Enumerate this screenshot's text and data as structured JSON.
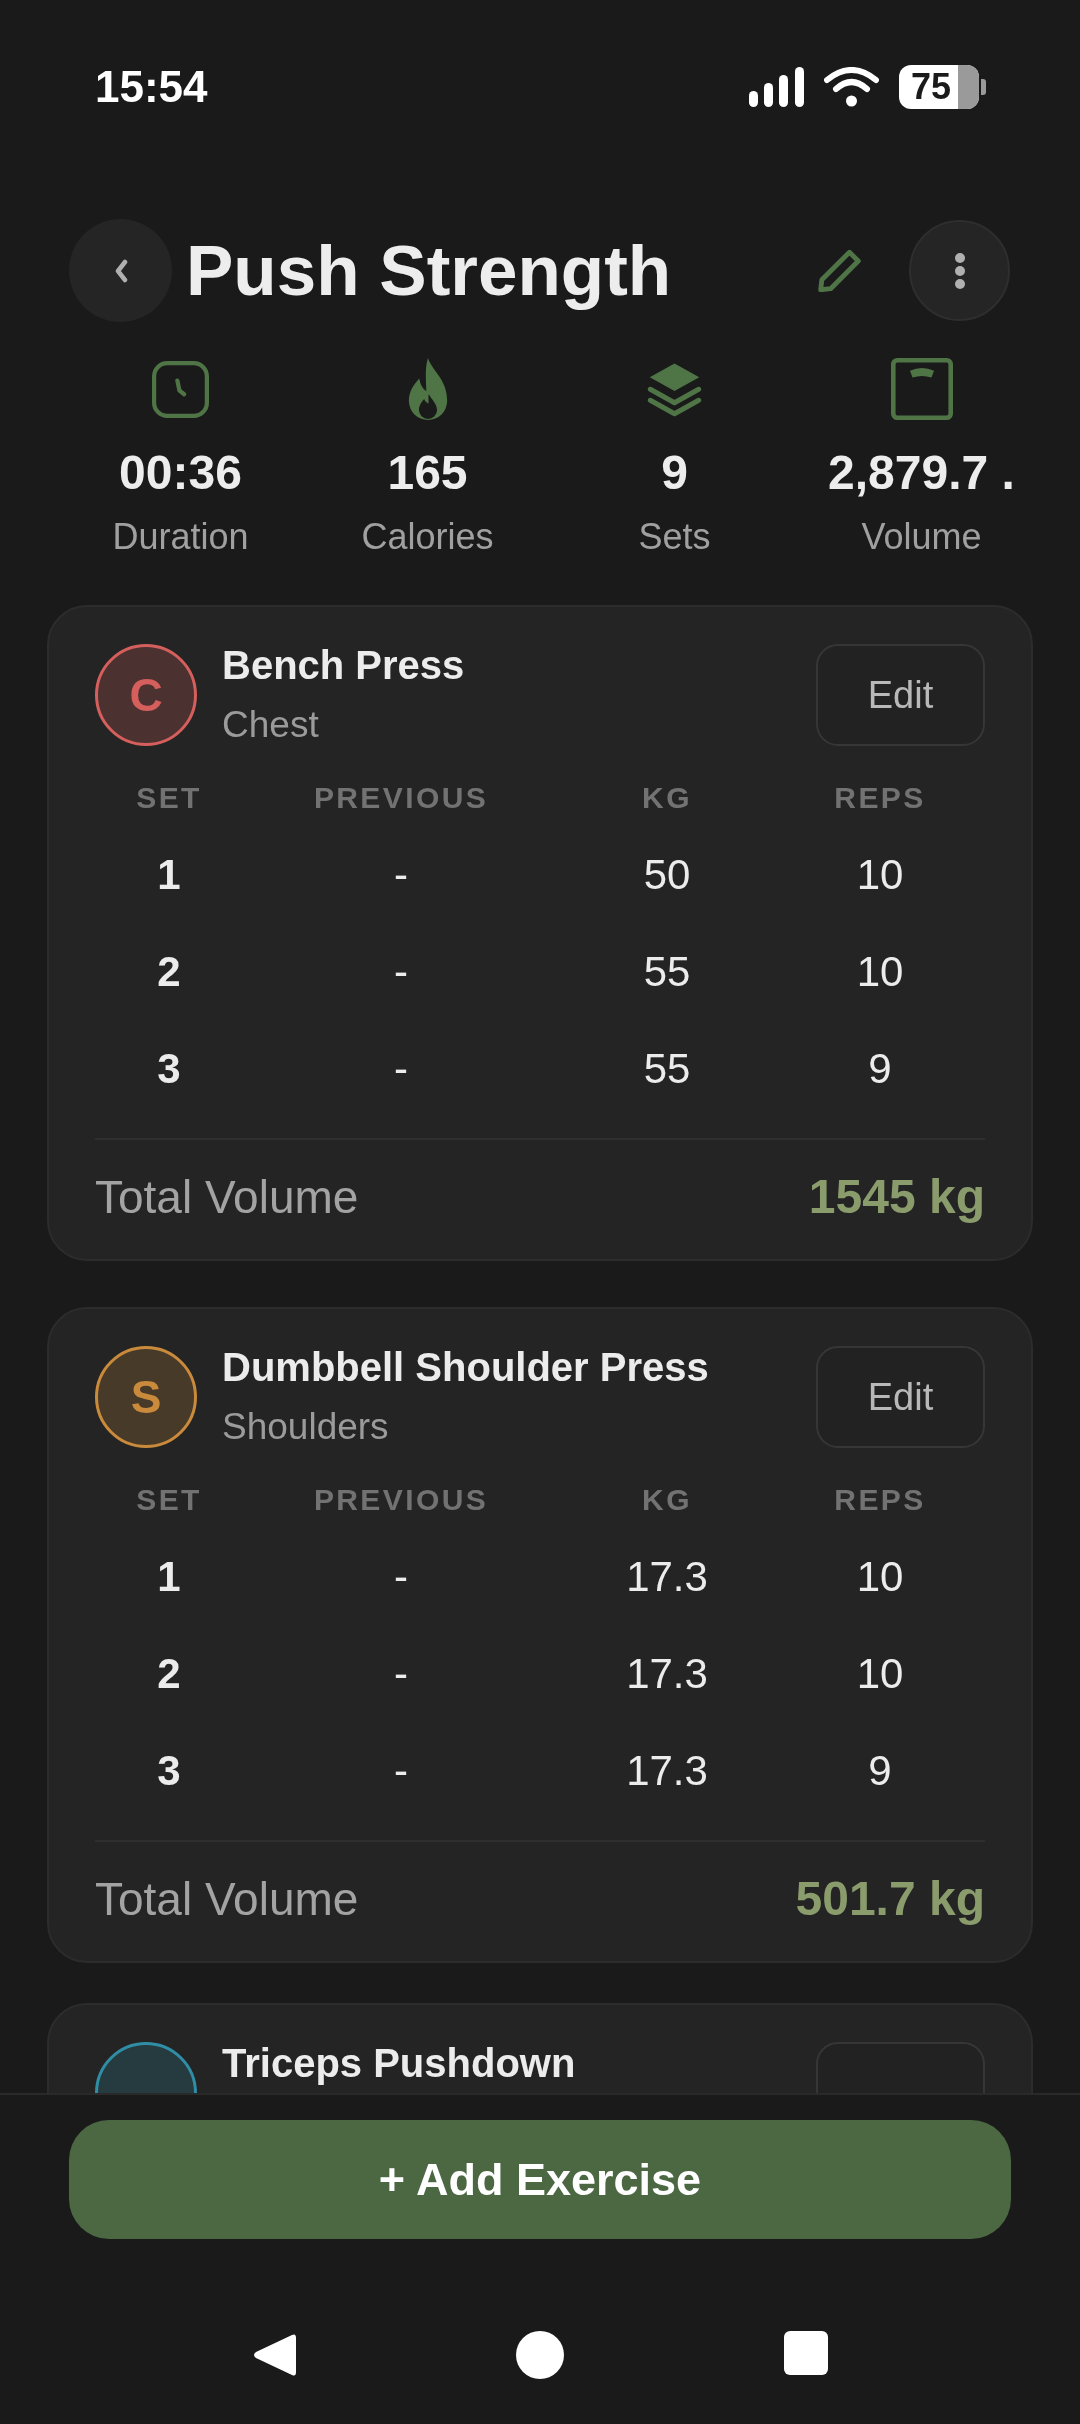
{
  "status_bar": {
    "time": "15:54",
    "battery": "75"
  },
  "header": {
    "title": "Push Strength"
  },
  "stats": [
    {
      "kind": "duration",
      "value": "00:36",
      "label": "Duration"
    },
    {
      "kind": "calories",
      "value": "165",
      "label": "Calories"
    },
    {
      "kind": "sets",
      "value": "9",
      "label": "Sets"
    },
    {
      "kind": "volume",
      "value": "2,879.7 .",
      "label": "Volume"
    }
  ],
  "exercises": [
    {
      "initial": "C",
      "name": "Bench Press",
      "muscle": "Chest",
      "color": "#d45f5c",
      "edit_label": "Edit",
      "columns": [
        "SET",
        "PREVIOUS",
        "KG",
        "REPS"
      ],
      "sets": [
        {
          "set": "1",
          "previous": "-",
          "kg": "50",
          "reps": "10"
        },
        {
          "set": "2",
          "previous": "-",
          "kg": "55",
          "reps": "10"
        },
        {
          "set": "3",
          "previous": "-",
          "kg": "55",
          "reps": "9"
        }
      ],
      "total_label": "Total Volume",
      "total": "1545 kg"
    },
    {
      "initial": "S",
      "name": "Dumbbell Shoulder Press",
      "muscle": "Shoulders",
      "color": "#c98a3c",
      "edit_label": "Edit",
      "columns": [
        "SET",
        "PREVIOUS",
        "KG",
        "REPS"
      ],
      "sets": [
        {
          "set": "1",
          "previous": "-",
          "kg": "17.3",
          "reps": "10"
        },
        {
          "set": "2",
          "previous": "-",
          "kg": "17.3",
          "reps": "10"
        },
        {
          "set": "3",
          "previous": "-",
          "kg": "17.3",
          "reps": "9"
        }
      ],
      "total_label": "Total Volume",
      "total": "501.7 kg"
    },
    {
      "name": "Triceps Pushdown",
      "color": "#2f8ea5"
    }
  ],
  "add_button": {
    "label": "+ Add Exercise"
  }
}
